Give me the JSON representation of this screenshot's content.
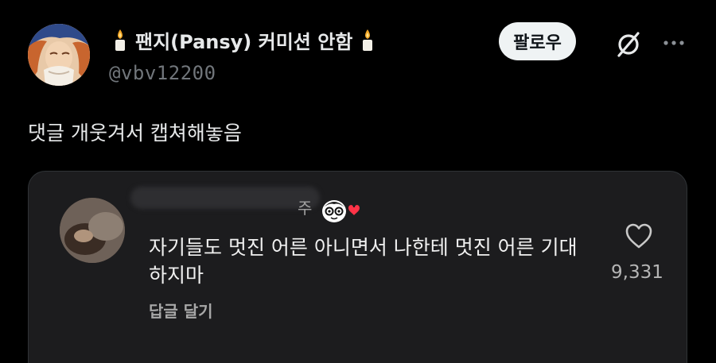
{
  "post": {
    "author": {
      "display_name": "팬지(Pansy) 커미션 안함",
      "handle": "@vbv12200",
      "avatar": "illustrated-avatar"
    },
    "follow_label": "팔로우",
    "text": "댓글 개웃겨서 캡쳐해놓음"
  },
  "embedded_comment": {
    "username_suffix": "주",
    "text": "자기들도 멋진 어른 아니면서 나한테 멋진 어른 기대하지마",
    "reply_label": "답글 달기",
    "like_count": "9,331",
    "icons": [
      "heart-icon",
      "smiley-heart-emoji"
    ]
  },
  "icons": [
    "candle-icon",
    "grok-icon",
    "more-icon"
  ],
  "colors": {
    "background": "#000000",
    "text": "#e7e9ea",
    "secondary": "#71767b",
    "follow_button_bg": "#eff3f4",
    "card_bg": "#1c1c1e"
  }
}
